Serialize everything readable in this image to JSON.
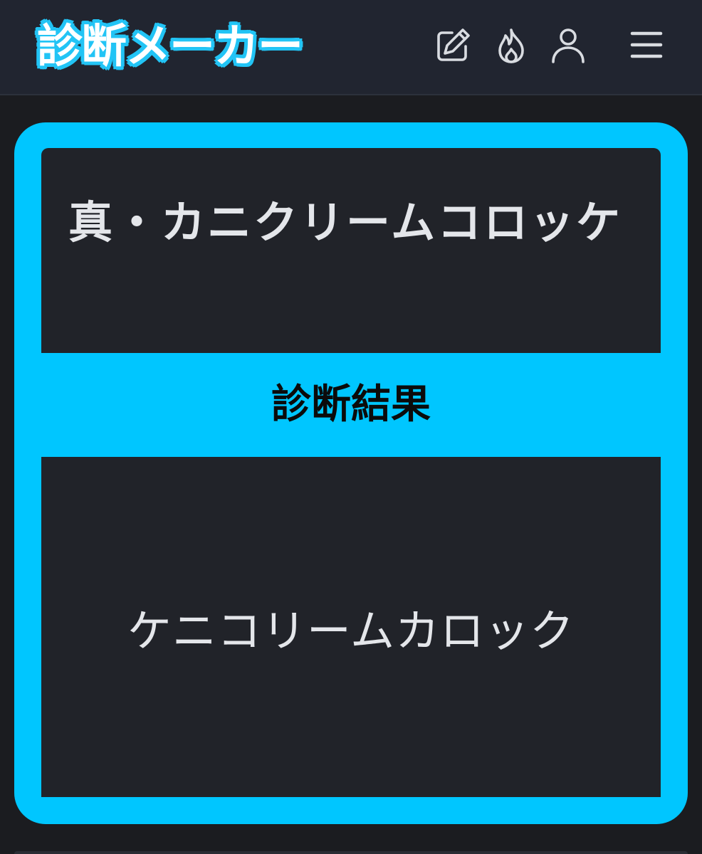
{
  "header": {
    "logo": "診断メーカー",
    "icons": [
      "edit-icon",
      "fire-icon",
      "user-icon",
      "menu-icon"
    ]
  },
  "diagnosis": {
    "title": "真・カニクリームコロッケ",
    "result_label": "診断結果",
    "result_text": "ケニコリームカロック"
  },
  "colors": {
    "accent": "#00c6ff",
    "logo_outline": "#22c4f5",
    "navbar_bg": "#212530",
    "panel_bg": "#212329",
    "page_bg": "#1b1c20",
    "text": "#e4e6ea"
  }
}
